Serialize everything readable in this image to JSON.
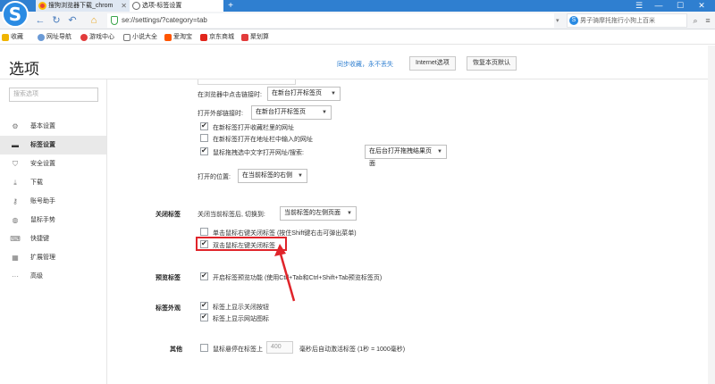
{
  "browser": {
    "logo": "S",
    "tabs": [
      {
        "label": "搜狗浏览器下载_chrom",
        "active": false
      },
      {
        "label": "选项-标签设置",
        "active": true
      }
    ],
    "new_tab": "+",
    "window_controls": [
      "☰",
      "—",
      "☐",
      "✕"
    ],
    "address": "se://settings/?category=tab",
    "address_dropdown": "▾",
    "search_placeholder": "男子骑摩托拖行小狗上百米",
    "search_logo": "S"
  },
  "bookmarks": [
    {
      "label": "收藏",
      "icon": "star-icon",
      "color": "#f0b400"
    },
    {
      "label": "网址导航",
      "icon": "globe-icon",
      "color": "#6a9ad6"
    },
    {
      "label": "游戏中心",
      "icon": "game-icon",
      "color": "#e23b3b"
    },
    {
      "label": "小说大全",
      "icon": "book-icon",
      "color": "#777777"
    },
    {
      "label": "爱淘宝",
      "icon": "taobao-icon",
      "color": "#ff5500"
    },
    {
      "label": "京东商城",
      "icon": "jd-icon",
      "color": "#e1251b"
    },
    {
      "label": "聚划算",
      "icon": "juhuasuan-icon",
      "color": "#e23b3b"
    }
  ],
  "page": {
    "title": "选项",
    "header_link": "同步收藏，永不丢失",
    "internet_button": "Internet选项",
    "restore_button": "恢复本页默认"
  },
  "sidebar": {
    "search_placeholder": "搜索选项",
    "items": [
      {
        "label": "基本设置",
        "icon": "gear-icon",
        "glyph": "⚙",
        "active": false
      },
      {
        "label": "标签设置",
        "icon": "tab-icon",
        "glyph": "▬",
        "active": true
      },
      {
        "label": "安全设置",
        "icon": "shield-icon",
        "glyph": "⛉",
        "active": false
      },
      {
        "label": "下载",
        "icon": "download-icon",
        "glyph": "⤓",
        "active": false
      },
      {
        "label": "账号助手",
        "icon": "key-icon",
        "glyph": "⚷",
        "active": false
      },
      {
        "label": "鼠标手势",
        "icon": "mouse-icon",
        "glyph": "◍",
        "active": false
      },
      {
        "label": "快捷键",
        "icon": "keyboard-icon",
        "glyph": "⌨",
        "active": false
      },
      {
        "label": "扩展管理",
        "icon": "extension-icon",
        "glyph": "▦",
        "active": false
      },
      {
        "label": "高级",
        "icon": "more-icon",
        "glyph": "···",
        "active": false
      }
    ]
  },
  "content": {
    "middle_click_label": "在浏览器中点击链接时:",
    "middle_click_value": "在新台打开标签页",
    "external_link_label": "打开外部链接时:",
    "external_link_value": "在新台打开标签页",
    "opt_open_bookmarks_newtab": {
      "label": "在新标签打开收藏栏里的网址",
      "checked": true
    },
    "opt_open_address_newtab": {
      "label": "在新标签打开在地址栏中输入的网址",
      "checked": false
    },
    "opt_drag_open": {
      "label": "鼠标拖拽选中文字打开网址/搜索:",
      "checked": true
    },
    "drag_open_value": "在后台打开拖拽结果页面",
    "open_position_label": "打开的位置:",
    "open_position_value": "在当前标签的右侧",
    "close_tab_section": "关闭标签",
    "after_close_label": "关闭当前标签后, 切换到:",
    "after_close_value": "当前标签的左侧页面",
    "opt_right_click_close": {
      "label": "单击鼠标右键关闭标签 (按住Shift键右击可弹出菜单)",
      "checked": false
    },
    "opt_double_click_close": {
      "label": "双击鼠标左键关闭标签",
      "checked": true
    },
    "preview_section": "预览标签",
    "opt_preview": {
      "label": "开启标签预览功能 (使用Ctrl+Tab和Ctrl+Shift+Tab预览标签页)",
      "checked": true
    },
    "appearance_section": "标签外观",
    "opt_show_close": {
      "label": "标签上显示关闭按钮",
      "checked": true
    },
    "opt_show_favicon": {
      "label": "标签上显示网站图标",
      "checked": true
    },
    "other_section": "其他",
    "opt_hover_switch": {
      "label": "鼠标悬停在标签上",
      "checked": false
    },
    "hover_delay_value": "400",
    "hover_delay_suffix": "毫秒后自动激活标签 (1秒 = 1000毫秒)"
  },
  "colors": {
    "tabbar": "#2f7fd0",
    "highlight": "#e0242a",
    "link": "#2f7fd0"
  }
}
